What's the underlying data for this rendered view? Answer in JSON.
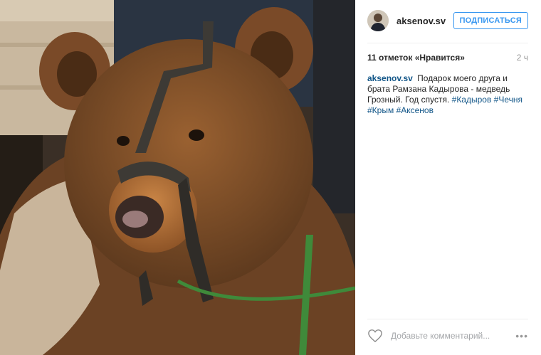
{
  "post": {
    "photo": {
      "icon": "bear-photo",
      "palette": {
        "fur": "#7a4a28",
        "fur_light": "#a8703f",
        "muzzle": "#b5723d",
        "background_dark": "#2c2a28",
        "leash": "#3f8a3a"
      }
    },
    "header": {
      "username": "aksenov.sv",
      "follow_label": "ПОДПИСАТЬСЯ"
    },
    "meta": {
      "likes": "11 отметок «Нравится»",
      "time": "2 ч"
    },
    "caption": {
      "author": "aksenov.sv",
      "text": "Подарок моего друга и брата Рамзана Кадырова - медведь Грозный. Год спустя.",
      "hashtags": [
        "#Кадыров",
        "#Чечня",
        "#Крым",
        "#Аксенов"
      ]
    },
    "comment": {
      "placeholder": "Добавьте комментарий...",
      "more_label": "•••"
    },
    "colors": {
      "accent": "#3897f0",
      "link": "#125688",
      "muted": "#999999"
    }
  }
}
